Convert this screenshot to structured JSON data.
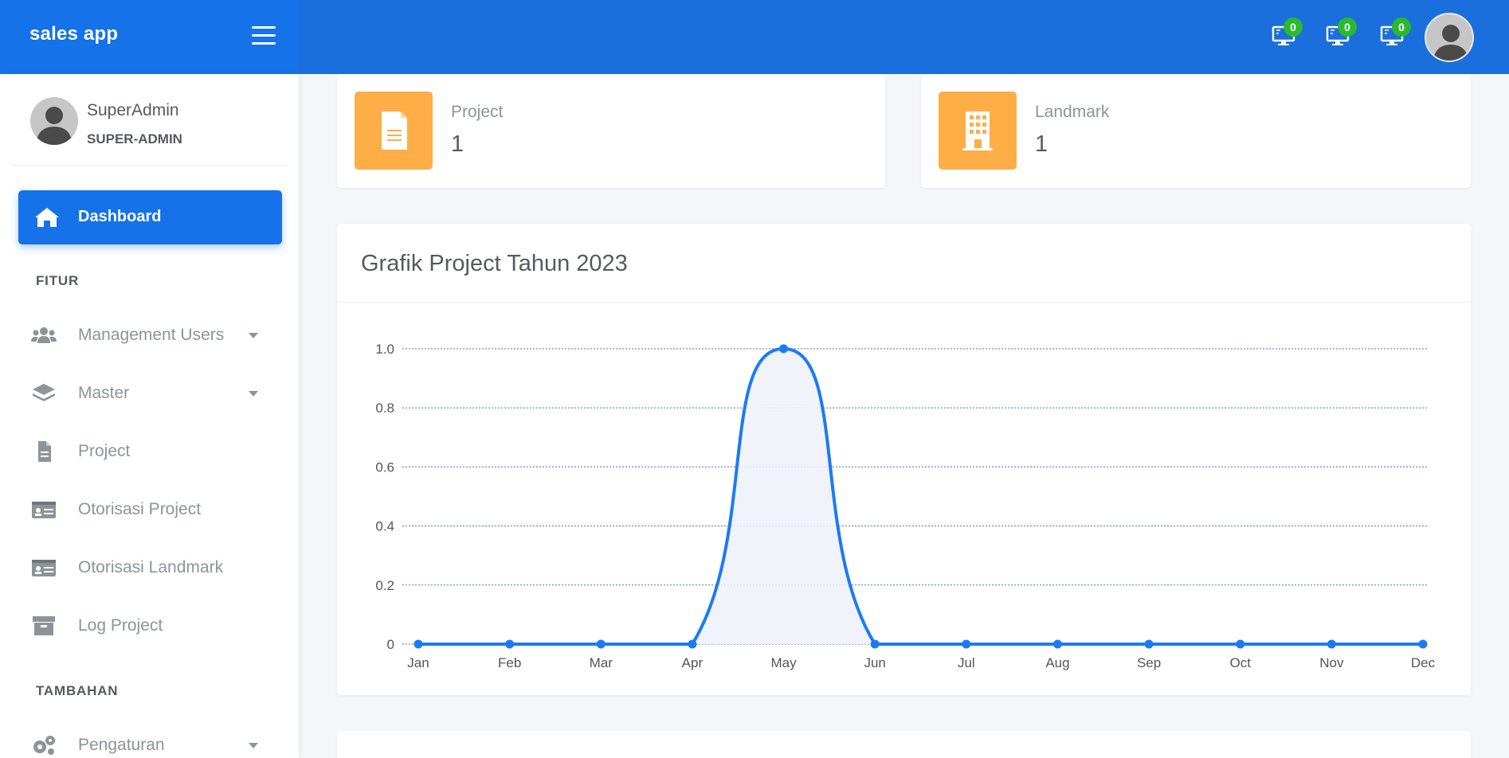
{
  "brand": {
    "title": "sales app"
  },
  "header": {
    "notifications": [
      {
        "icon": "monitor-icon",
        "count": "0"
      },
      {
        "icon": "monitor-icon",
        "count": "0"
      },
      {
        "icon": "monitor-icon",
        "count": "0"
      }
    ],
    "colors": {
      "bar": "#1a6fdc",
      "brand": "#1572e8",
      "badge": "#2bb930"
    }
  },
  "user": {
    "name": "SuperAdmin",
    "role": "SUPER-ADMIN"
  },
  "sidebar": {
    "active": {
      "label": "Dashboard",
      "icon": "home-icon"
    },
    "sections": [
      {
        "title": "FITUR"
      },
      {
        "title": "TAMBAHAN"
      }
    ],
    "items": [
      {
        "label": "Management Users",
        "icon": "users-icon",
        "caret": true
      },
      {
        "label": "Master",
        "icon": "layers-icon",
        "caret": true
      },
      {
        "label": "Project",
        "icon": "file-icon",
        "caret": false
      },
      {
        "label": "Otorisasi Project",
        "icon": "id-card-icon",
        "caret": false
      },
      {
        "label": "Otorisasi Landmark",
        "icon": "id-card-icon",
        "caret": false
      },
      {
        "label": "Log Project",
        "icon": "archive-icon",
        "caret": false
      },
      {
        "label": "Pengaturan",
        "icon": "gears-icon",
        "caret": true
      }
    ]
  },
  "stats": [
    {
      "label": "Project",
      "value": "1",
      "icon": "file-icon",
      "color": "#ffad46"
    },
    {
      "label": "Landmark",
      "value": "1",
      "icon": "building-icon",
      "color": "#ffad46"
    }
  ],
  "chart": {
    "title": "Grafik Project Tahun 2023"
  },
  "chart_data": {
    "type": "line",
    "title": "Grafik Project Tahun 2023",
    "categories": [
      "Jan",
      "Feb",
      "Mar",
      "Apr",
      "May",
      "Jun",
      "Jul",
      "Aug",
      "Sep",
      "Oct",
      "Nov",
      "Dec"
    ],
    "series": [
      {
        "values": [
          0,
          0,
          0,
          0,
          1,
          0,
          0,
          0,
          0,
          0,
          0,
          0
        ],
        "color": "#1d7af3"
      }
    ],
    "yticks": [
      "0",
      "0.2",
      "0.4",
      "0.6",
      "0.8",
      "1.0"
    ],
    "ylim": [
      0,
      1
    ],
    "grid": true,
    "fill": true
  }
}
